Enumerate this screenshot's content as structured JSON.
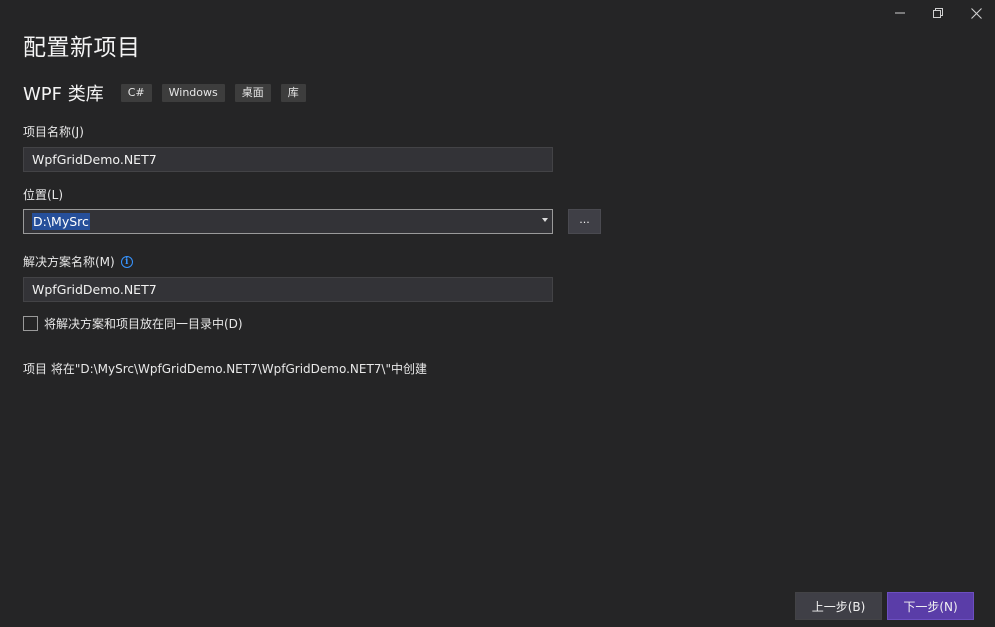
{
  "window": {
    "title": "配置新项目",
    "icons": [
      "minimize-icon",
      "restore-icon",
      "close-icon"
    ]
  },
  "template": {
    "name": "WPF 类库",
    "tags": [
      "C#",
      "Windows",
      "桌面",
      "库"
    ]
  },
  "project_name": {
    "label": "项目名称(J)",
    "value": "WpfGridDemo.NET7"
  },
  "location": {
    "label": "位置(L)",
    "value": "D:\\MySrc",
    "browse_label": "..."
  },
  "solution_name": {
    "label": "解决方案名称(M)",
    "info_icon": "i",
    "value": "WpfGridDemo.NET7"
  },
  "same_directory": {
    "label": "将解决方案和项目放在同一目录中(D)",
    "checked": false
  },
  "path_info": "项目 将在\"D:\\MySrc\\WpfGridDemo.NET7\\WpfGridDemo.NET7\\\"中创建",
  "footer": {
    "back_label": "上一步(B)",
    "next_label": "下一步(N)"
  },
  "colors": {
    "background": "#252526",
    "field_bg": "#333337",
    "accent_next": "#5a3da8",
    "info_blue": "#3794ff",
    "selection": "#264f9a"
  }
}
